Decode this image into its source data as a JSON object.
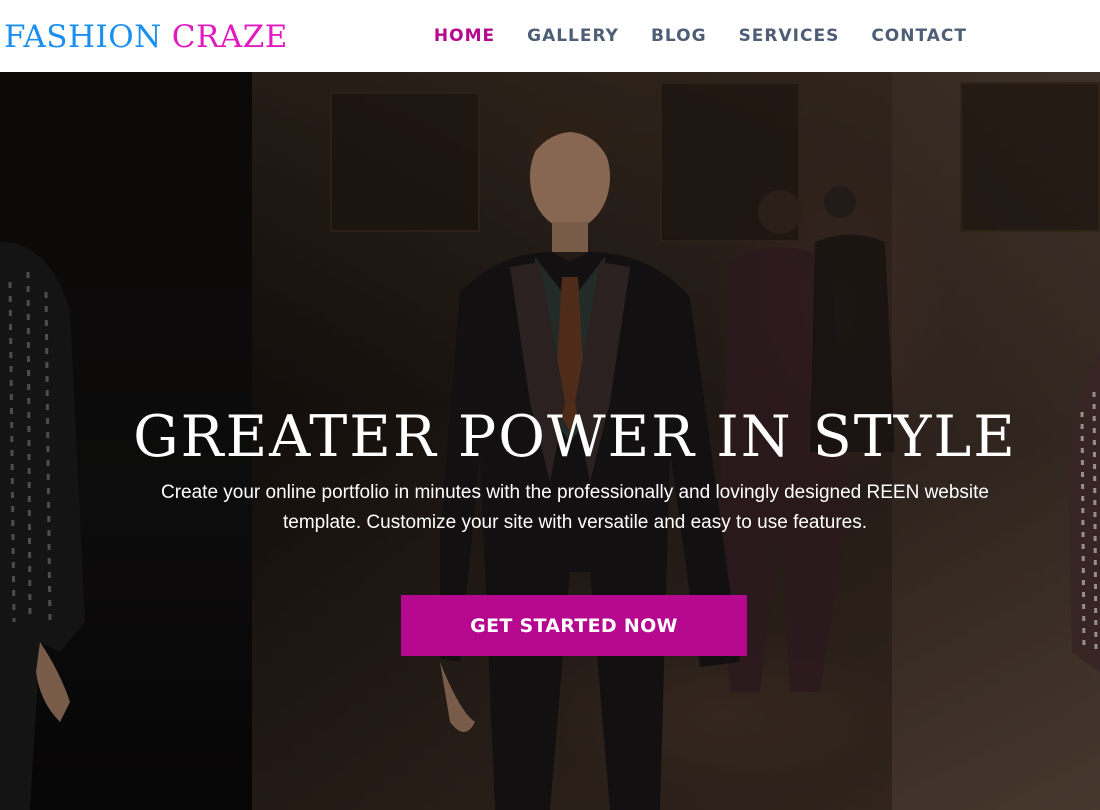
{
  "logo": {
    "part1": "FASHION",
    "part2": "CRAZE"
  },
  "nav": {
    "items": [
      {
        "label": "HOME",
        "active": true
      },
      {
        "label": "GALLERY",
        "active": false
      },
      {
        "label": "BLOG",
        "active": false
      },
      {
        "label": "SERVICES",
        "active": false
      },
      {
        "label": "CONTACT",
        "active": false
      }
    ]
  },
  "hero": {
    "title": "GREATER POWER IN STYLE",
    "subtitle_line1": "Create your online portfolio in minutes with the professionally and lovingly designed REEN website",
    "subtitle_line2": "template. Customize your site with versatile and easy to use features.",
    "cta_label": "GET STARTED NOW"
  },
  "colors": {
    "logo_primary": "#1a8ff0",
    "logo_accent": "#e21bc0",
    "nav_text": "#4e5e76",
    "nav_active": "#b5088f",
    "cta_background": "#b5088f"
  }
}
